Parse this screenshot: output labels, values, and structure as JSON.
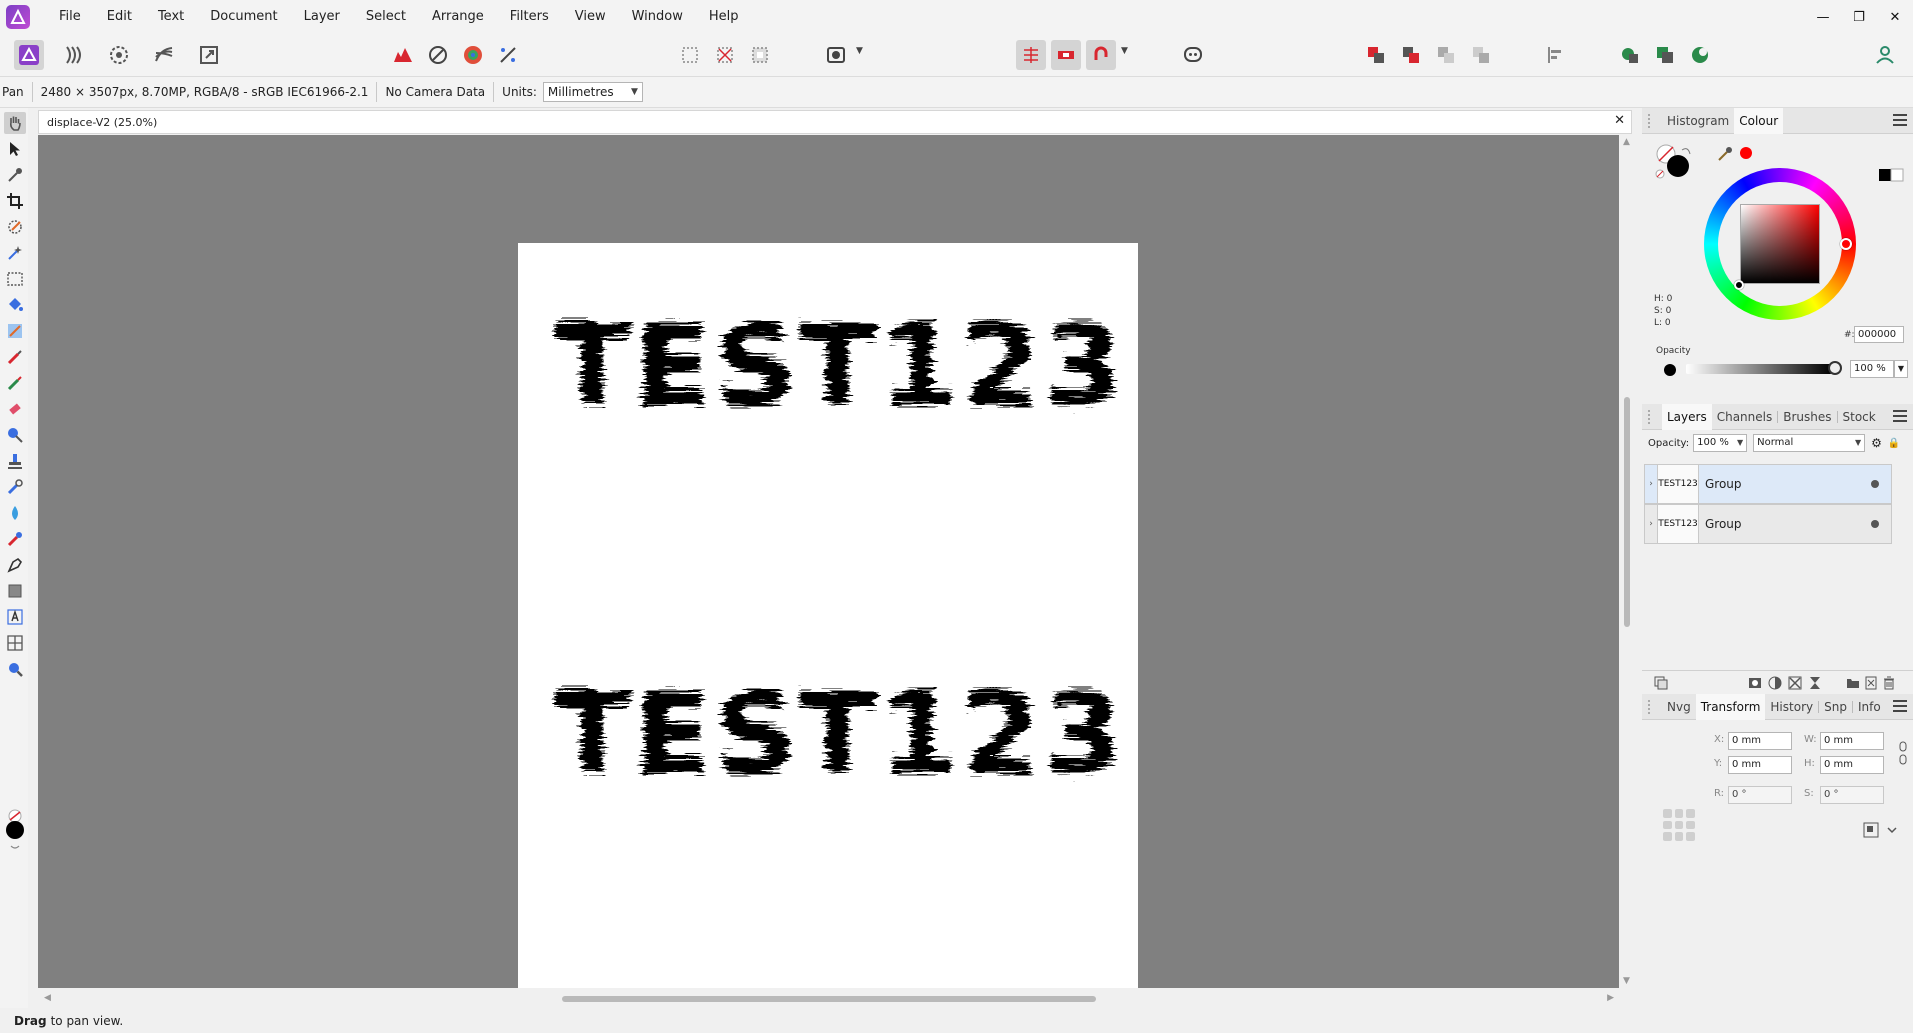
{
  "menubar": {
    "items": [
      "File",
      "Edit",
      "Text",
      "Document",
      "Layer",
      "Select",
      "Arrange",
      "Filters",
      "View",
      "Window",
      "Help"
    ]
  },
  "context": {
    "tool_name": "Pan",
    "image_info": "2480 × 3507px, 8.70MP, RGBA/8 - sRGB IEC61966-2.1",
    "camera": "No Camera Data",
    "units_label": "Units:",
    "units_value": "Millimetres"
  },
  "document": {
    "tab_title": "displace-V2 (25.0%)",
    "text_top": "TEST123",
    "text_bottom": "TEST123"
  },
  "status": {
    "bold": "Drag",
    "rest": "to pan view."
  },
  "colour_panel": {
    "tabs": [
      "Histogram",
      "Colour"
    ],
    "active_tab": "Colour",
    "h": "H: 0",
    "s": "S: 0",
    "l": "L: 0",
    "hex_label": "#:",
    "hex": "000000",
    "opacity_label": "Opacity",
    "opacity_value": "100 %",
    "colors": {
      "primary": "#000000",
      "accent": "#ff0000"
    }
  },
  "layers_panel": {
    "tabs": [
      "Layers",
      "Channels",
      "Brushes",
      "Stock"
    ],
    "active_tab": "Layers",
    "opacity_label": "Opacity:",
    "opacity_value": "100 %",
    "blend_mode": "Normal",
    "layers": [
      {
        "thumb": "TEST123",
        "name": "Group",
        "selected": true
      },
      {
        "thumb": "TEST123",
        "name": "Group",
        "selected": false
      }
    ]
  },
  "transform_panel": {
    "tabs": [
      "Nvg",
      "Transform",
      "History",
      "Snp",
      "Info"
    ],
    "active_tab": "Transform",
    "x_label": "X:",
    "x": "0 mm",
    "y_label": "Y:",
    "y": "0 mm",
    "w_label": "W:",
    "w": "0 mm",
    "h_label": "H:",
    "h": "0 mm",
    "r_label": "R:",
    "r": "0 °",
    "s_label": "S:",
    "s": "0 °"
  }
}
